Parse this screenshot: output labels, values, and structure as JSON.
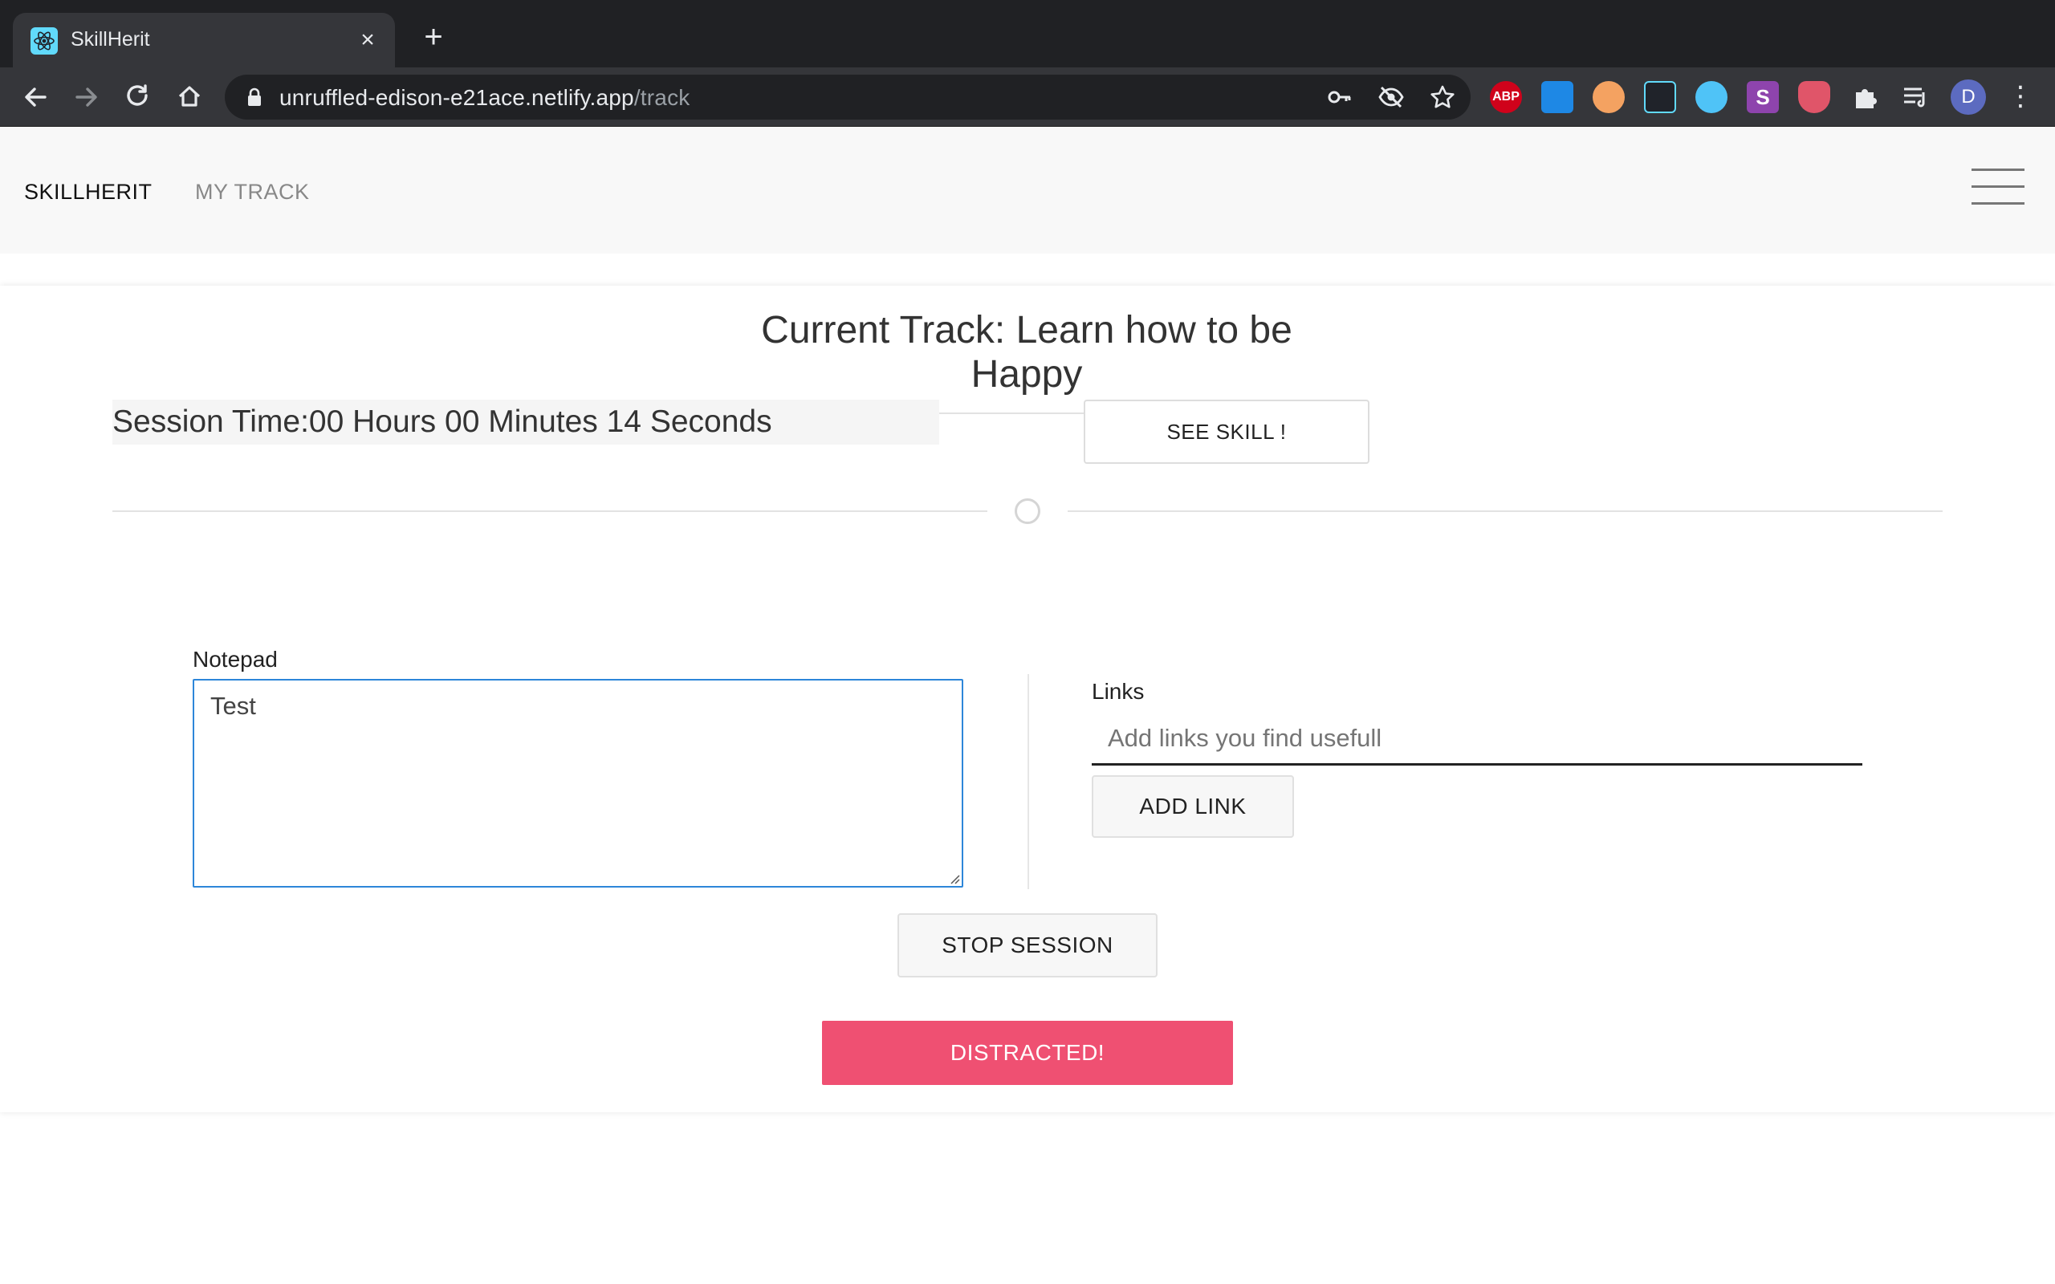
{
  "browser": {
    "tab_title": "SkillHerit",
    "tab_close": "×",
    "new_tab": "+",
    "url_host": "unruffled-edison-e21ace.netlify.app",
    "url_path": "/track",
    "extensions": [
      {
        "name": "adblock-plus-icon",
        "label": "ABP",
        "color": "#d0021b"
      },
      {
        "name": "window-extension-icon",
        "label": "",
        "color": "#1e88e5"
      },
      {
        "name": "glasses-extension-icon",
        "label": "",
        "color": "#f4a261"
      },
      {
        "name": "react-devtools-icon",
        "label": "",
        "color": "#61dafb"
      },
      {
        "name": "circle-extension-icon",
        "label": "",
        "color": "#4fc3f7"
      },
      {
        "name": "s-extension-icon",
        "label": "S",
        "color": "#8e44ad"
      },
      {
        "name": "shield-extension-icon",
        "label": "",
        "color": "#e05569"
      }
    ],
    "profile_initial": "D"
  },
  "navbar": {
    "brand": "SKILLHERIT",
    "link": "MY TRACK"
  },
  "track": {
    "title": "Current Track: Learn how to be Happy",
    "session_time": "Session Time:00 Hours 00 Minutes 14 Seconds",
    "see_skill": "SEE SKILL !"
  },
  "notepad": {
    "label": "Notepad",
    "value": "Test"
  },
  "links": {
    "label": "Links",
    "placeholder": "Add links you find usefull",
    "add_button": "ADD LINK"
  },
  "actions": {
    "stop_session": "STOP SESSION",
    "distracted": "DISTRACTED!"
  },
  "colors": {
    "accent_distracted": "#ef5072",
    "focus_border": "#2d86d9"
  }
}
